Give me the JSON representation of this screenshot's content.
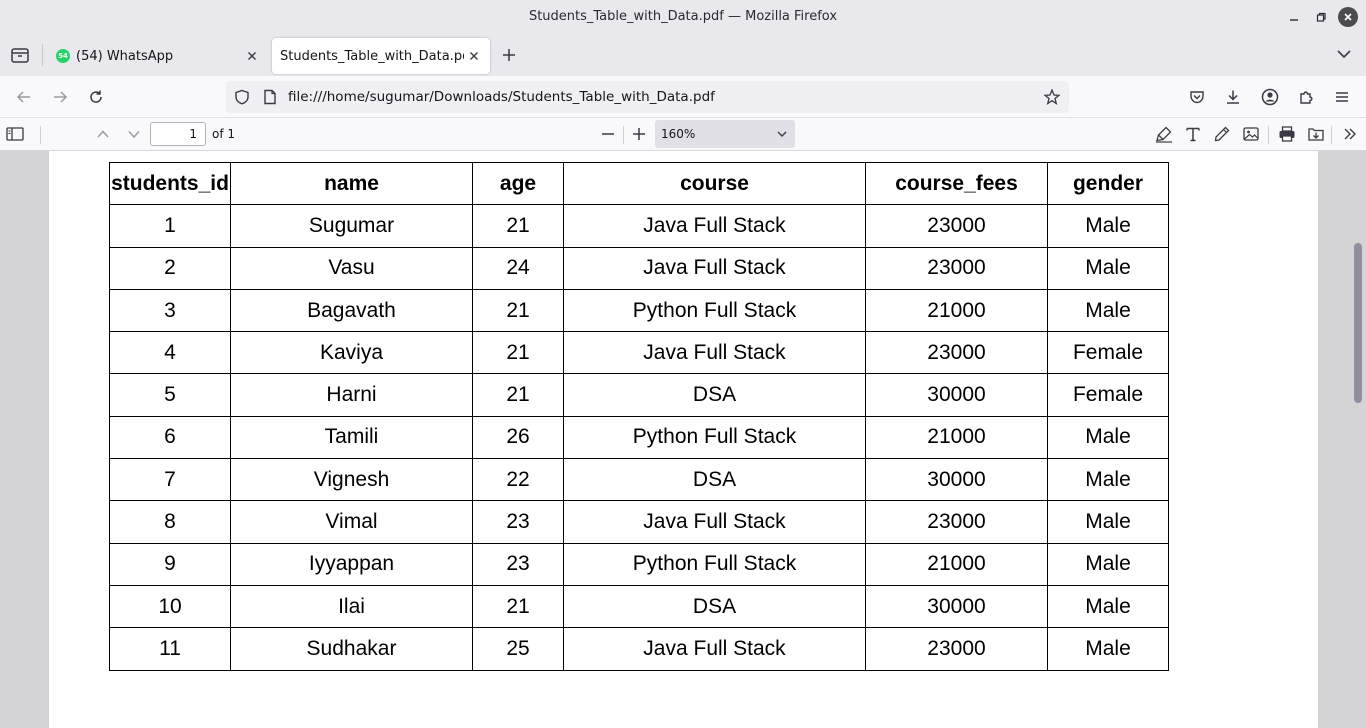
{
  "window": {
    "title": "Students_Table_with_Data.pdf — Mozilla Firefox"
  },
  "tabs": [
    {
      "label": "(54) WhatsApp",
      "badge": "54",
      "active": false
    },
    {
      "label": "Students_Table_with_Data.pdf",
      "active": true
    }
  ],
  "navbar": {
    "url": "file:///home/sugumar/Downloads/Students_Table_with_Data.pdf"
  },
  "pdf_toolbar": {
    "page_number": "1",
    "page_count_label": "of 1",
    "zoom": "160%"
  },
  "table": {
    "headers": [
      "students_id",
      "name",
      "age",
      "course",
      "course_fees",
      "gender"
    ],
    "rows": [
      [
        "1",
        "Sugumar",
        "21",
        "Java Full Stack",
        "23000",
        "Male"
      ],
      [
        "2",
        "Vasu",
        "24",
        "Java Full Stack",
        "23000",
        "Male"
      ],
      [
        "3",
        "Bagavath",
        "21",
        "Python Full Stack",
        "21000",
        "Male"
      ],
      [
        "4",
        "Kaviya",
        "21",
        "Java Full Stack",
        "23000",
        "Female"
      ],
      [
        "5",
        "Harni",
        "21",
        "DSA",
        "30000",
        "Female"
      ],
      [
        "6",
        "Tamili",
        "26",
        "Python Full Stack",
        "21000",
        "Male"
      ],
      [
        "7",
        "Vignesh",
        "22",
        "DSA",
        "30000",
        "Male"
      ],
      [
        "8",
        "Vimal",
        "23",
        "Java Full Stack",
        "23000",
        "Male"
      ],
      [
        "9",
        "Iyyappan",
        "23",
        "Python Full Stack",
        "21000",
        "Male"
      ],
      [
        "10",
        "Ilai",
        "21",
        "DSA",
        "30000",
        "Male"
      ],
      [
        "11",
        "Sudhakar",
        "25",
        "Java Full Stack",
        "23000",
        "Male"
      ]
    ]
  },
  "colors": {
    "accent_whatsapp": "#25d366",
    "chrome_bg": "#e8e8ed",
    "viewer_bg": "#d4d4d7"
  }
}
